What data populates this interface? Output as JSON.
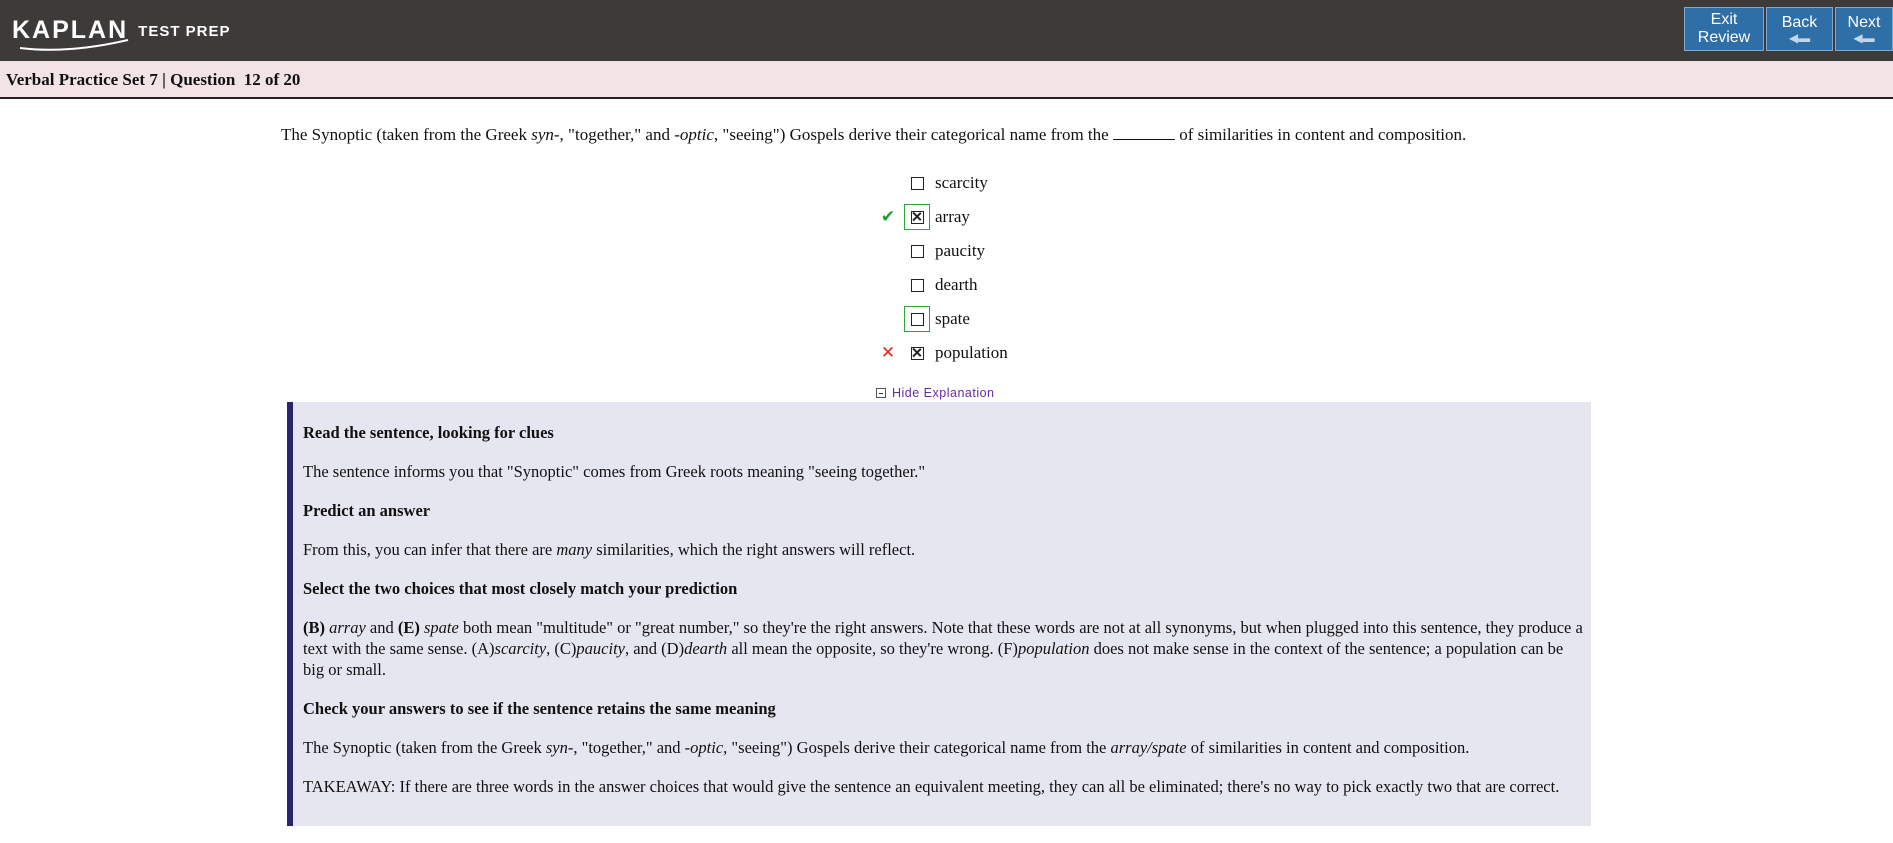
{
  "header": {
    "logo_text": "KAPLAN",
    "logo_sub": "TEST PREP",
    "buttons": {
      "exit_line1": "Exit",
      "exit_line2": "Review",
      "back": "Back",
      "next": "Next"
    }
  },
  "subheader": {
    "title": "Verbal Practice Set 7 | Question  12 of 20"
  },
  "question": {
    "part1": "The Synoptic (taken from the Greek ",
    "em1": "syn-",
    "part2": ", \"together,\" and ",
    "em2": "-optic",
    "part3": ", \"seeing\") Gospels derive their categorical name from the ",
    "part4": " of similarities in content and composition."
  },
  "choices": [
    {
      "label": "scarcity",
      "checked": false,
      "highlight": false,
      "mark": ""
    },
    {
      "label": "array",
      "checked": true,
      "highlight": true,
      "mark": "✔"
    },
    {
      "label": "paucity",
      "checked": false,
      "highlight": false,
      "mark": ""
    },
    {
      "label": "dearth",
      "checked": false,
      "highlight": false,
      "mark": ""
    },
    {
      "label": "spate",
      "checked": false,
      "highlight": true,
      "mark": ""
    },
    {
      "label": "population",
      "checked": true,
      "highlight": false,
      "mark": "✕"
    }
  ],
  "explanation": {
    "toggle_label": "Hide Explanation",
    "h1": "Read the sentence, looking for clues",
    "p1": "The sentence informs you that \"Synoptic\" comes from Greek roots meaning \"seeing together.\"",
    "h2": "Predict an answer",
    "p2a": "From this, you can infer that there are ",
    "p2em": "many",
    "p2b": " similarities, which the right answers will reflect.",
    "h3": "Select the two choices that most closely match your prediction",
    "p3": {
      "b1": "(B)",
      "e1": " array",
      "t1": " and ",
      "b2": "(E)",
      "e2": " spate",
      "t2": " both mean \"multitude\" or \"great number,\" so they're the right answers. Note that these words are not at all synonyms, but when plugged into this sentence, they produce a text with the same sense. (A)",
      "e3": "scarcity",
      "t3": ", (C)",
      "e4": "paucity",
      "t4": ", and (D)",
      "e5": "dearth",
      "t5": " all mean the opposite, so they're wrong. (F)",
      "e6": "population",
      "t6": " does not make sense in the context of the sentence; a population can be big or small."
    },
    "h4": "Check your answers to see if the sentence retains the same meaning",
    "p4": {
      "t1": "The Synoptic (taken from the Greek ",
      "e1": "syn-",
      "t2": ", \"together,\" and ",
      "e2": "-optic",
      "t3": ", \"seeing\") Gospels derive their categorical name from the ",
      "e3": "array/spate",
      "t4": " of similarities in content and composition."
    },
    "p5": "TAKEAWAY: If there are three words in the answer choices that would give the sentence an equivalent meeting, they can all be eliminated; there's no way to pick exactly two that are correct."
  },
  "colors": {
    "header_bg": "#3d3a3a",
    "button_bg": "#2f6fa7",
    "subbar_bg": "#f2e3e6",
    "explanation_bg": "#e6e6f0",
    "explanation_accent": "#2a2370",
    "correct": "#1aa128",
    "wrong": "#e2261c"
  }
}
